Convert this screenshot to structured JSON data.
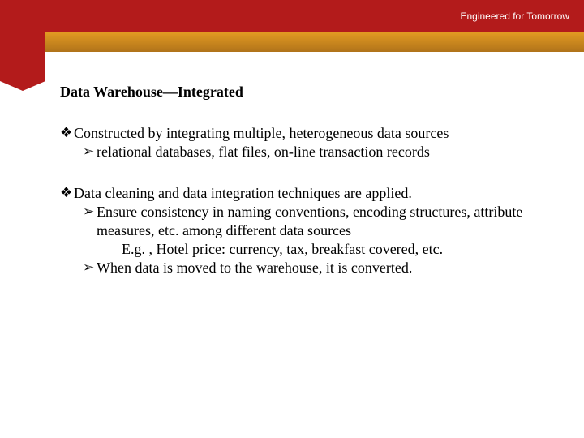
{
  "header": {
    "tagline": "Engineered for Tomorrow"
  },
  "slide": {
    "title": "Data Warehouse—Integrated",
    "group1": {
      "b1": "Constructed by integrating multiple, heterogeneous data sources",
      "b1a": "relational databases, flat files, on-line transaction records"
    },
    "group2": {
      "b2": "Data cleaning and data integration techniques are applied.",
      "b2a": "Ensure consistency in naming conventions, encoding structures, attribute measures, etc. among different data sources",
      "b2a_eg": "E.g. , Hotel price: currency, tax, breakfast covered, etc.",
      "b2b": "When data is moved to the warehouse, it is converted."
    },
    "markers": {
      "diamond": "❖",
      "arrow": "➢"
    }
  }
}
